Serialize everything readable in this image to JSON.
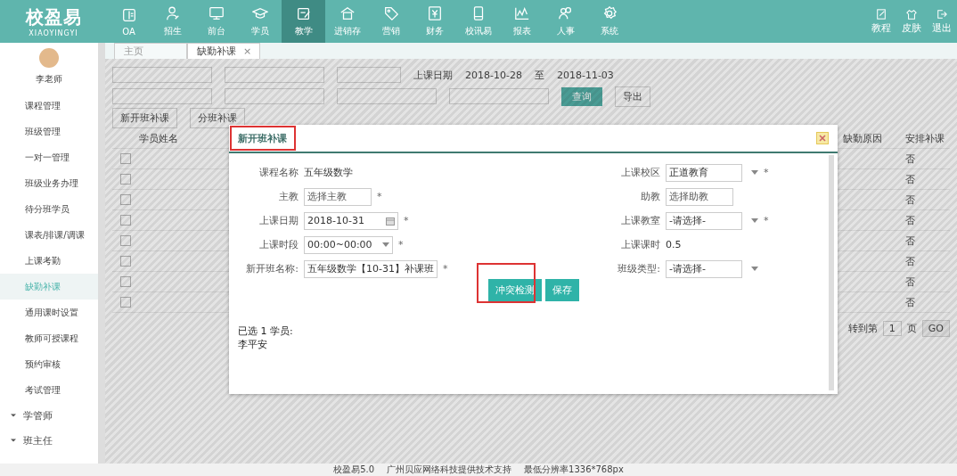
{
  "brand": {
    "name": "校盈易",
    "subtitle": "XIAOYINGYI"
  },
  "nav": [
    {
      "label": "OA",
      "selected": false
    },
    {
      "label": "招生",
      "selected": false
    },
    {
      "label": "前台",
      "selected": false
    },
    {
      "label": "学员",
      "selected": false
    },
    {
      "label": "教学",
      "selected": true
    },
    {
      "label": "进销存",
      "selected": false
    },
    {
      "label": "营销",
      "selected": false
    },
    {
      "label": "财务",
      "selected": false
    },
    {
      "label": "校讯易",
      "selected": false
    },
    {
      "label": "报表",
      "selected": false
    },
    {
      "label": "人事",
      "selected": false
    },
    {
      "label": "系统",
      "selected": false
    }
  ],
  "nav_right": [
    "教程",
    "皮肤",
    "退出"
  ],
  "user": {
    "name": "李老师"
  },
  "sidebar": {
    "items": [
      {
        "label": "课程管理",
        "selected": false
      },
      {
        "label": "班级管理",
        "selected": false
      },
      {
        "label": "一对一管理",
        "selected": false
      },
      {
        "label": "班级业务办理",
        "selected": false
      },
      {
        "label": "待分班学员",
        "selected": false
      },
      {
        "label": "课表/排课/调课",
        "selected": false
      },
      {
        "label": "上课考勤",
        "selected": false
      },
      {
        "label": "缺勤补课",
        "selected": true
      },
      {
        "label": "通用课时设置",
        "selected": false
      },
      {
        "label": "教师可授课程",
        "selected": false
      },
      {
        "label": "预约审核",
        "selected": false
      },
      {
        "label": "考试管理",
        "selected": false
      }
    ],
    "groups": [
      {
        "label": "学管师",
        "expanded": false
      },
      {
        "label": "班主任",
        "expanded": false
      }
    ]
  },
  "tabs": [
    {
      "label": "主页",
      "selected": false
    },
    {
      "label": "缺勤补课",
      "selected": true,
      "close": "×"
    }
  ],
  "filters": {
    "date_label": "上课日期",
    "date_from": "2018-10-28",
    "date_sep": "至",
    "date_to": "2018-11-03",
    "search_button": "查询",
    "export_button": "导出"
  },
  "actions": [
    "新开班补课",
    "分班补课"
  ],
  "table": {
    "columns": [
      "学员姓名",
      "缺勤原因",
      "安排补课"
    ],
    "rows": [
      {
        "checked": false,
        "column_3": "否"
      },
      {
        "checked": false,
        "column_3": "否"
      },
      {
        "checked": false,
        "column_3": "否"
      },
      {
        "checked": false,
        "column_3": "否"
      },
      {
        "checked": false,
        "column_3": "否"
      },
      {
        "checked": false,
        "column_3": "否"
      },
      {
        "checked": false,
        "column_3": "否"
      },
      {
        "checked": false,
        "column_3": "否"
      }
    ]
  },
  "pagination": {
    "goto_label": "转到第",
    "page": "1",
    "page_unit": "页",
    "go_button": "GO"
  },
  "modal": {
    "title": "新开班补课",
    "required_mark": "*",
    "left_fields": [
      {
        "label": "课程名称",
        "kind": "text",
        "value": "五年级数学",
        "required": false
      },
      {
        "label": "主教",
        "kind": "input",
        "placeholder": "选择主教",
        "required": true
      },
      {
        "label": "上课日期",
        "kind": "date",
        "value": "2018-10-31",
        "required": true
      },
      {
        "label": "上课时段",
        "kind": "select",
        "value": "00:00~00:00",
        "required": true
      },
      {
        "label": "新开班名称:",
        "kind": "input",
        "value": "五年级数学【10-31】补课班",
        "required": true
      }
    ],
    "right_fields": [
      {
        "label": "上课校区",
        "kind": "select",
        "value": "正道教育",
        "required": true
      },
      {
        "label": "助教",
        "kind": "input",
        "placeholder": "选择助教",
        "required": false
      },
      {
        "label": "上课教室",
        "kind": "select",
        "value": "-请选择-",
        "required": true
      },
      {
        "label": "上课课时",
        "kind": "text",
        "value": "0.5",
        "required": false
      },
      {
        "label": "班级类型:",
        "kind": "select",
        "value": "-请选择-",
        "required": false
      }
    ],
    "buttons": [
      "冲突检测",
      "保存"
    ],
    "selected_label": "已选 1 学员:",
    "selected_students": "李平安"
  },
  "footer": [
    "校盈易5.0",
    "广州贝应网络科技提供技术支持",
    "最低分辨率1336*768px"
  ]
}
